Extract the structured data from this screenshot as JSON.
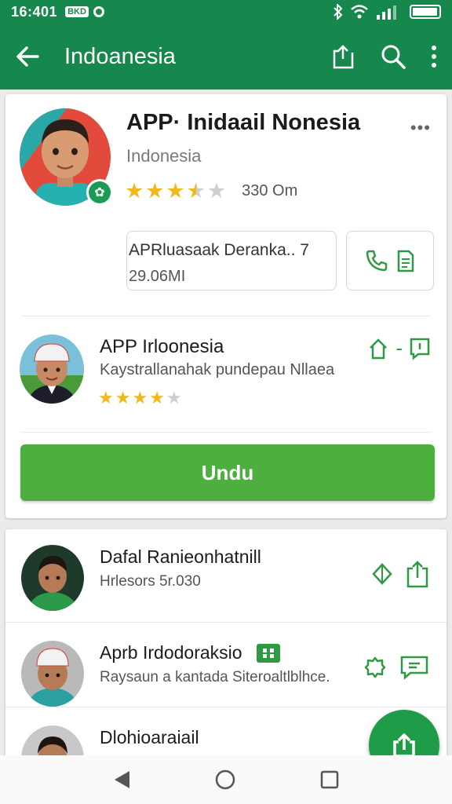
{
  "status_bar": {
    "time": "16:401",
    "notif_chip": "BKD",
    "battery_level": 0.85
  },
  "app_bar": {
    "title": "Indoanesia"
  },
  "hero": {
    "title": "APP· Inidaail Nonesia",
    "subtitle": "Indonesia",
    "rating": 3.5,
    "rating_count": "330 Om",
    "info_line1": "APRluasaak Deranka.. 7",
    "info_line2": "29.06MI"
  },
  "sub_app": {
    "title": "APP Irloonesia",
    "description": "Kaystrallanahak pundepau Nllaea",
    "rating": 4.5
  },
  "download_button": "Undu",
  "list": [
    {
      "name": "Dafal Ranieonhatnill",
      "description": "Hrlesors 5r.030"
    },
    {
      "name": "Aprb Irdodoraksio",
      "description": "Raysaun a kantada Siteroaltlblhce."
    },
    {
      "name": "Dlohioaraiail",
      "description": ""
    }
  ],
  "colors": {
    "primary": "#16884e",
    "accent": "#4caf3e",
    "star": "#f1b91d",
    "icon_green": "#2e9a44"
  }
}
